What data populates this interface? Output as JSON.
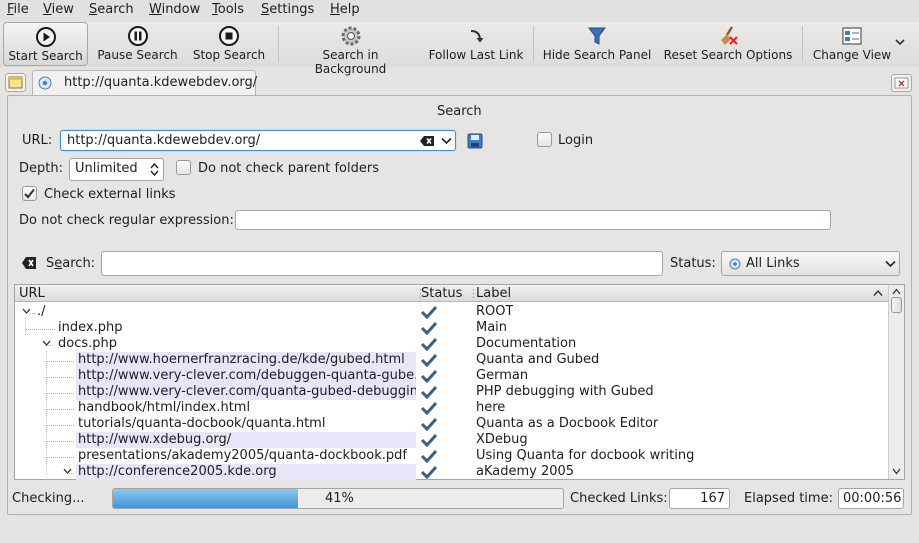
{
  "menu": [
    {
      "pre": "",
      "u": "F",
      "post": "ile"
    },
    {
      "pre": "",
      "u": "V",
      "post": "iew"
    },
    {
      "pre": "",
      "u": "S",
      "post": "earch"
    },
    {
      "pre": "",
      "u": "W",
      "post": "indow"
    },
    {
      "pre": "",
      "u": "T",
      "post": "ools"
    },
    {
      "pre": "",
      "u": "S",
      "post": "ettings"
    },
    {
      "pre": "",
      "u": "H",
      "post": "elp"
    }
  ],
  "toolbar": {
    "start_search": "Start Search",
    "pause_search": "Pause Search",
    "stop_search": "Stop Search",
    "search_background": "Search in Background",
    "follow_last_link": "Follow Last Link",
    "hide_search_panel": "Hide Search Panel",
    "reset_search_options": "Reset Search Options",
    "change_view": "Change View"
  },
  "tab": {
    "title": "http://quanta.kdewebdev.org/"
  },
  "search_panel": {
    "title": "Search",
    "url_label": "URL:",
    "url_value": "http://quanta.kdewebdev.org/",
    "login_label": "Login",
    "depth_label": "Depth:",
    "depth_value": "Unlimited",
    "no_parent_label": "Do not check parent folders",
    "external_label": "Check external links",
    "regex_label": "Do not check regular expression:",
    "regex_value": ""
  },
  "filter": {
    "search_label": "Search:",
    "search_value": "",
    "status_label": "Status:",
    "status_value": "All Links"
  },
  "table": {
    "headers": {
      "url": "URL",
      "status": "Status",
      "label": "Label"
    },
    "rows": [
      {
        "url": "./",
        "label": "ROOT"
      },
      {
        "url": "index.php",
        "label": "Main"
      },
      {
        "url": "docs.php",
        "label": "Documentation"
      },
      {
        "url": "http://www.hoernerfranzracing.de/kde/gubed.html",
        "label": "Quanta and Gubed"
      },
      {
        "url": "http://www.very-clever.com/debuggen-quanta-gube...",
        "label": "German"
      },
      {
        "url": "http://www.very-clever.com/quanta-gubed-debuggin...",
        "label": "PHP debugging with Gubed"
      },
      {
        "url": "handbook/html/index.html",
        "label": "here"
      },
      {
        "url": "tutorials/quanta-docbook/quanta.html",
        "label": "Quanta as a Docbook Editor"
      },
      {
        "url": "http://www.xdebug.org/",
        "label": "XDebug"
      },
      {
        "url": "presentations/akademy2005/quanta-dockbook.pdf",
        "label": "Using Quanta for docbook writing"
      },
      {
        "url": "http://conference2005.kde.org",
        "label": "aKademy 2005"
      }
    ]
  },
  "status_bar": {
    "checking": "Checking...",
    "progress": 41,
    "progress_text": "41%",
    "checked_links_label": "Checked Links:",
    "checked_links": "167",
    "elapsed_label": "Elapsed time:",
    "elapsed": "00:00:56"
  },
  "colors": {
    "ok_status": "#3a5f86",
    "progress": "#4a9fe0",
    "row_highlight": "#e6e6f8"
  }
}
